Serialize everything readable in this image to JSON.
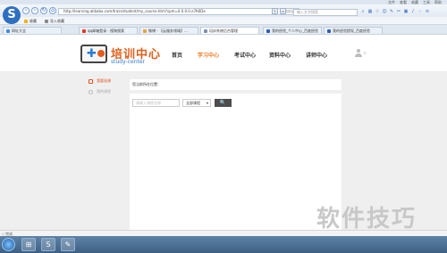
{
  "browser": {
    "title_menus": [
      "文件",
      "查看",
      "收藏",
      "工具",
      "帮助"
    ],
    "nav_back": "‹",
    "nav_forward": "›",
    "nav_refresh": "↻",
    "nav_home": "⌂",
    "address": "http://learning.alibaba.com/train/student/my_course.htm?spm=0.0.0.0.e7K6De",
    "address_tag": "虚拟机器",
    "search_placeholder": "输入文字搜索"
  },
  "favorites": {
    "fav_label": "收藏",
    "import_label": "导入收藏"
  },
  "tabs": [
    {
      "label": "网址大全"
    },
    {
      "label": "qq邮箱登录 - 搜狗搜索"
    },
    {
      "label": "微博 - 【云服务领域】..."
    },
    {
      "label": "培训系统后台管理"
    },
    {
      "label": "我的经验_个人中心_百度经验"
    },
    {
      "label": "我的经验提现_百度经验"
    }
  ],
  "site": {
    "brand_cn": "培训中心",
    "brand_en": "study-center",
    "nav": [
      {
        "label": "首页"
      },
      {
        "label": "学习中心"
      },
      {
        "label": "考试中心"
      },
      {
        "label": "资料中心"
      },
      {
        "label": "讲师中心"
      }
    ],
    "user_name": "c"
  },
  "sidebar": [
    {
      "label": "我要选课"
    },
    {
      "label": "我的课程"
    }
  ],
  "breadcrumb": "您当前所在位置：",
  "filter": {
    "keyword_placeholder": "请输入课程名称",
    "select_value": "全部课程",
    "select_arrow": "▾",
    "search_button": "🔍"
  },
  "status": {
    "mark": "◇",
    "text": "完成"
  },
  "taskbar": {
    "items": [
      "⊞",
      "S",
      "✎"
    ]
  },
  "watermark": "软件技巧",
  "colors": {
    "accent_orange": "#ef7a20",
    "brand_blue": "#2b7bd6",
    "sidebar_active": "#e2501b"
  }
}
